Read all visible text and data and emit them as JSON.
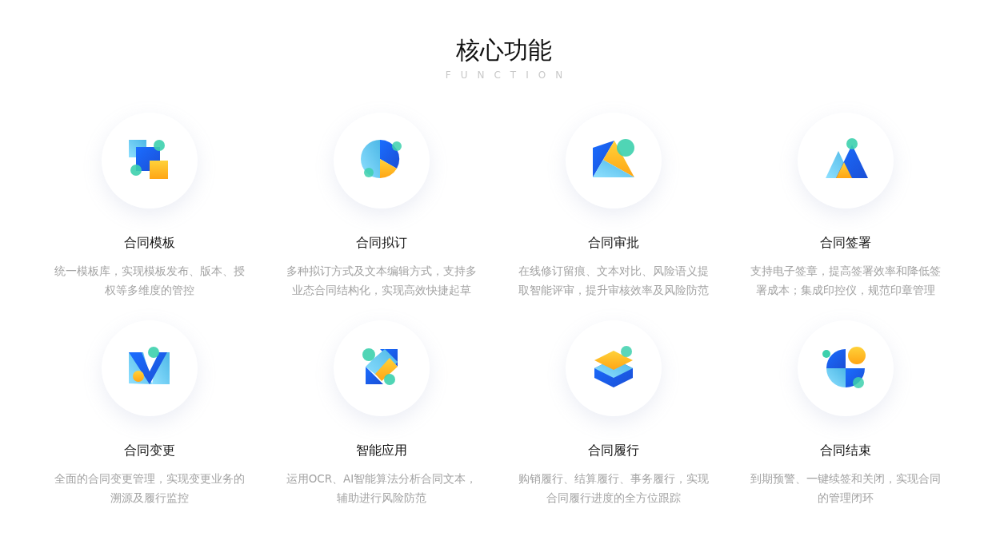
{
  "heading": {
    "title": "核心功能",
    "subtitle": "FUNCTION"
  },
  "features": [
    {
      "title": "合同模板",
      "description": "统一模板库，实现模板发布、版本、授权等多维度的管控"
    },
    {
      "title": "合同拟订",
      "description": "多种拟订方式及文本编辑方式，支持多业态合同结构化，实现高效快捷起草"
    },
    {
      "title": "合同审批",
      "description": "在线修订留痕、文本对比、风险语义提取智能评审，提升审核效率及风险防范"
    },
    {
      "title": "合同签署",
      "description": "支持电子签章，提高签署效率和降低签署成本；集成印控仪，规范印章管理"
    },
    {
      "title": "合同变更",
      "description": "全面的合同变更管理，实现变更业务的溯源及履行监控"
    },
    {
      "title": "智能应用",
      "description": "运用OCR、AI智能算法分析合同文本，辅助进行风险防范"
    },
    {
      "title": "合同履行",
      "description": "购销履行、结算履行、事务履行，实现合同履行进度的全方位跟踪"
    },
    {
      "title": "合同结束",
      "description": "到期预警、一键续签和关闭，实现合同的管理闭环"
    }
  ]
}
